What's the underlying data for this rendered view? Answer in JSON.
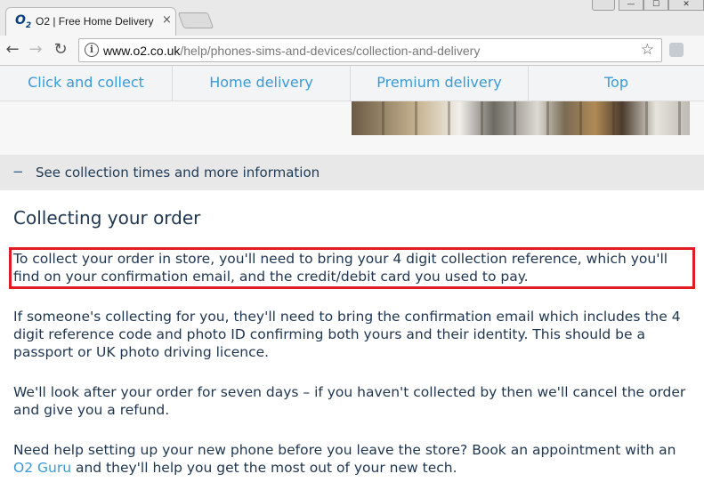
{
  "browser": {
    "tab_title": "O2 | Free Home Delivery",
    "tab_close": "×",
    "favicon_letter": "O",
    "favicon_sub": "2",
    "url_host": "www.o2.co.uk",
    "url_path": "/help/phones-sims-and-devices/collection-and-delivery",
    "info_glyph": "i",
    "star_glyph": "☆",
    "back_glyph": "←",
    "forward_glyph": "→",
    "reload_glyph": "↻",
    "win_user_glyph": "👤",
    "win_min_glyph": "—",
    "win_max_glyph": "☐",
    "win_close_glyph": "✕"
  },
  "subnav": {
    "items": [
      {
        "label": "Click and collect"
      },
      {
        "label": "Home delivery"
      },
      {
        "label": "Premium delivery"
      },
      {
        "label": "Top"
      }
    ]
  },
  "collapse": {
    "icon": "−",
    "label": "See collection times and more information"
  },
  "content": {
    "heading": "Collecting your order",
    "p1": "To collect your order in store, you'll need to bring your 4 digit collection reference, which you'll find on your confirmation email, and the credit/debit card you used to pay.",
    "p2": "If someone's collecting for you, they'll need to bring the confirmation email which includes the 4 digit reference code and photo ID confirming both yours and their identity. This should be a passport or UK photo driving licence.",
    "p3": "We'll look after your order for seven days – if you haven't collected by then we'll cancel the order and give you a refund.",
    "p4_before": "Need help setting up your new phone before you leave the store? Book an appointment with an ",
    "p4_link": "O2 Guru",
    "p4_after": " and they'll help you get the most out of your new tech."
  },
  "colors": {
    "accent_blue": "#3b9ad6",
    "text_navy": "#1e3550",
    "highlight_red": "#e01b24"
  }
}
